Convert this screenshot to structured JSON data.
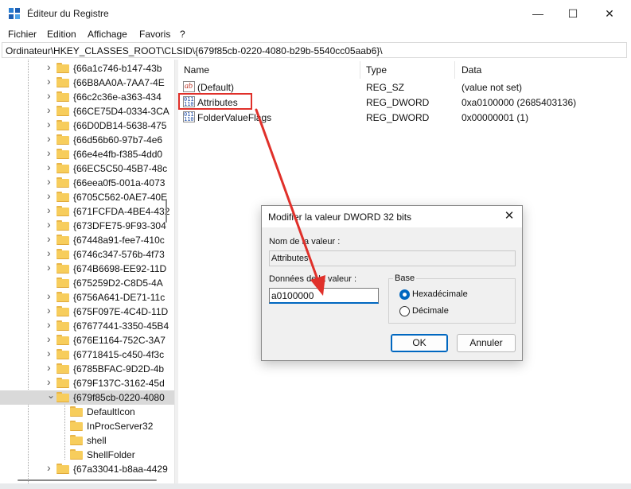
{
  "window": {
    "title": "Éditeur du Registre",
    "minimize_glyph": "—",
    "maximize_glyph": "☐",
    "close_glyph": "✕"
  },
  "menu": [
    "Fichier",
    "Edition",
    "Affichage",
    "Favoris",
    "?"
  ],
  "address": "Ordinateur\\HKEY_CLASSES_ROOT\\CLSID\\{679f85cb-0220-4080-b29b-5540cc05aab6}\\",
  "tree": {
    "keys": [
      "{66a1c746-b147-43b",
      "{66B8AA0A-7AA7-4E",
      "{66c2c36e-a363-434",
      "{66CE75D4-0334-3CA",
      "{66D0DB14-5638-475",
      "{66d56b60-97b7-4e6",
      "{66e4e4fb-f385-4dd0",
      "{66EC5C50-45B7-48c",
      "{66eea0f5-001a-4073",
      "{6705C562-0AE7-40E",
      "{671FCFDA-4BE4-432",
      "{673DFE75-9F93-304",
      "{67448a91-fee7-410c",
      "{6746c347-576b-4f73",
      "{674B6698-EE92-11D",
      "{675259D2-C8D5-4A",
      "{6756A641-DE71-11c",
      "{675F097E-4C4D-11D",
      "{67677441-3350-45B4",
      "{676E1164-752C-3A7",
      "{67718415-c450-4f3c",
      "{6785BFAC-9D2D-4b",
      "{679F137C-3162-45d",
      "{679f85cb-0220-4080"
    ],
    "subkeys": [
      "DefaultIcon",
      "InProcServer32",
      "shell",
      "ShellFolder"
    ],
    "after_key": "{67a33041-b8aa-4429"
  },
  "columns": {
    "name": "Name",
    "type": "Type",
    "data": "Data"
  },
  "values": [
    {
      "icon": "string-value-icon",
      "glyph": "ab",
      "name": "(Default)",
      "type": "REG_SZ",
      "data": "(value not set)"
    },
    {
      "icon": "binary-value-icon",
      "glyph": "011 110",
      "name": "Attributes",
      "type": "REG_DWORD",
      "data": "0xa0100000 (2685403136)"
    },
    {
      "icon": "binary-value-icon",
      "glyph": "011 110",
      "name": "FolderValueFlags",
      "type": "REG_DWORD",
      "data": "0x00000001 (1)"
    }
  ],
  "dialog": {
    "title": "Modifier la valeur DWORD 32 bits",
    "close_glyph": "✕",
    "name_label": "Nom de la valeur :",
    "name_value": "Attributes",
    "data_label": "Données de la valeur :",
    "data_value": "a0100000",
    "base_label": "Base",
    "radio_hex": "Hexadécimale",
    "radio_dec": "Décimale",
    "ok": "OK",
    "cancel": "Annuler"
  },
  "colors": {
    "annotation_red": "#e0302a",
    "accent": "#0067c0",
    "folder": "#f7cd5c"
  }
}
